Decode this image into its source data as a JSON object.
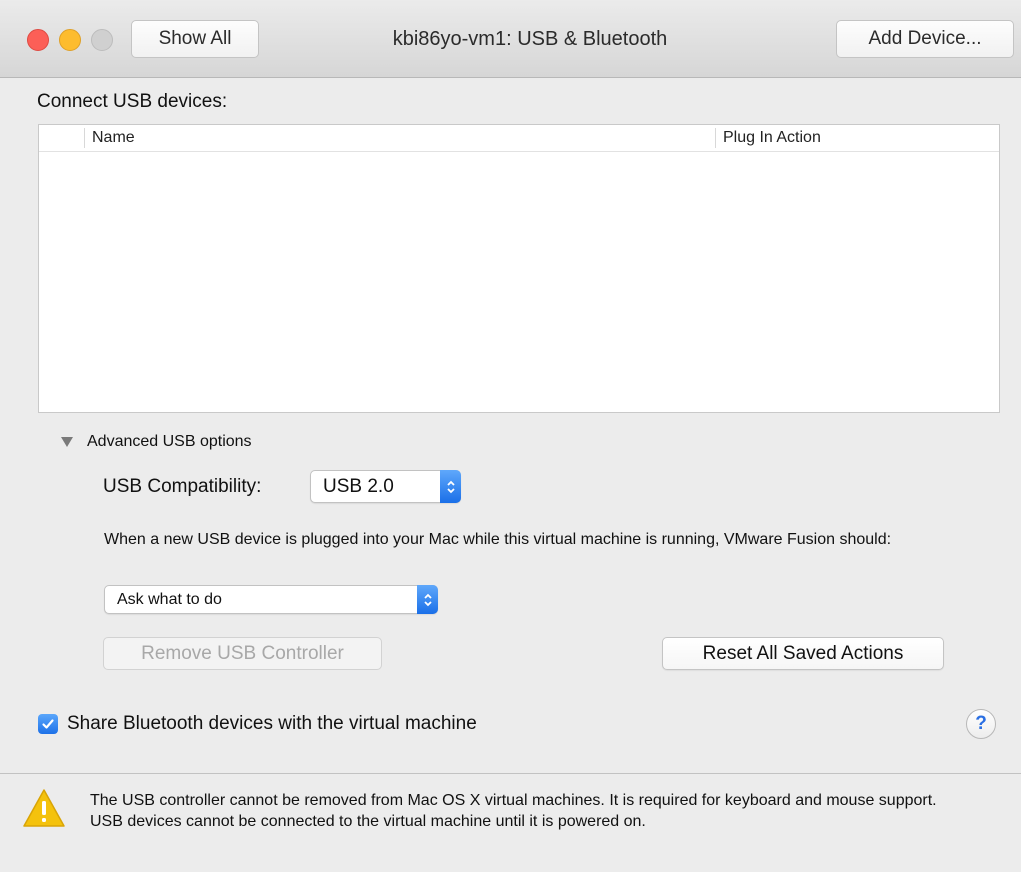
{
  "window": {
    "title": "kbi86yo-vm1: USB & Bluetooth",
    "show_all": "Show All",
    "add_device": "Add Device..."
  },
  "usb": {
    "section_label": "Connect USB devices:",
    "columns": [
      "Name",
      "Plug In Action"
    ],
    "rows": []
  },
  "advanced": {
    "label": "Advanced USB options",
    "compat_label": "USB Compatibility:",
    "compat_value": "USB 2.0",
    "description": "When a new USB device is plugged into your Mac while this virtual machine is running, VMware Fusion should:",
    "plug_action": "Ask what to do",
    "remove_button": "Remove USB Controller",
    "reset_button": "Reset All Saved Actions"
  },
  "bluetooth": {
    "label": "Share Bluetooth devices with the virtual machine",
    "checked": true
  },
  "help_label": "?",
  "footer": {
    "line1": "The USB controller cannot be removed from Mac OS X virtual machines. It is required for keyboard and mouse support.",
    "line2": "USB devices cannot be connected to the virtual machine until it is powered on."
  },
  "colors": {
    "accent": "#1a6fe8",
    "close": "#fc5f57",
    "minimize": "#fdbc2e",
    "warning": "#f4c20d"
  }
}
